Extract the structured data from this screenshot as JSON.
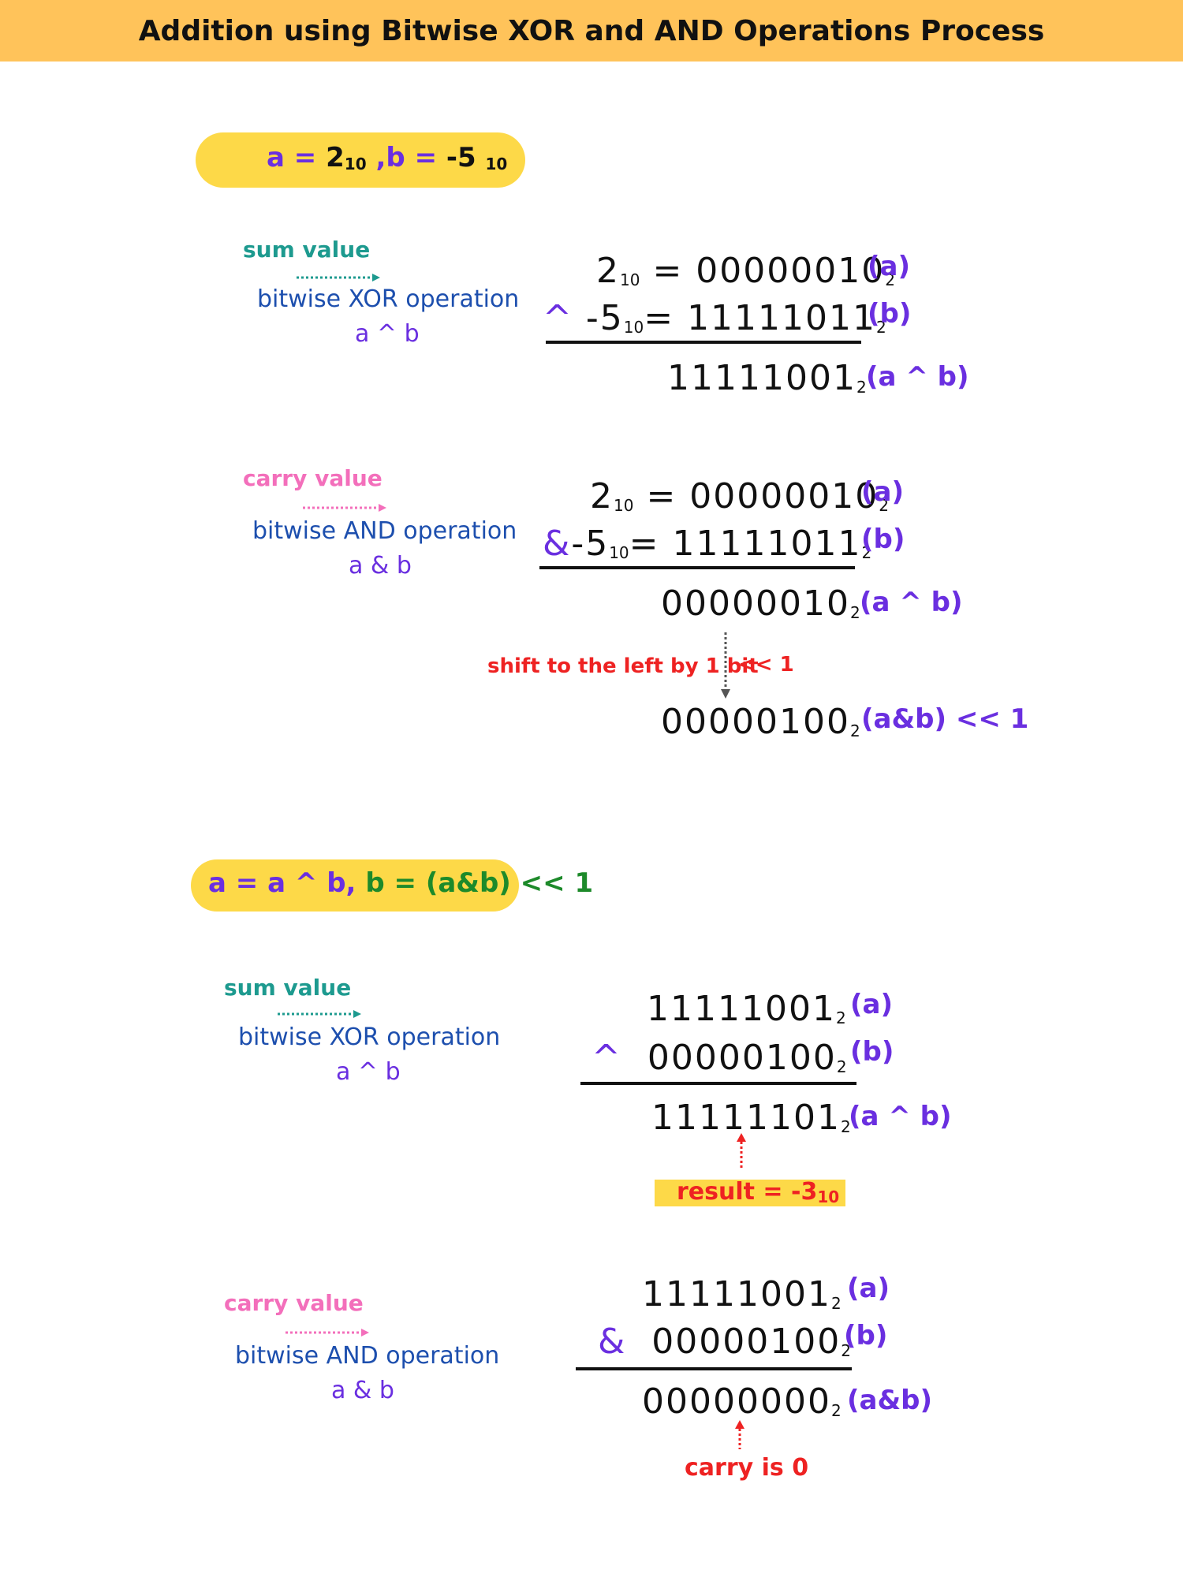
{
  "title": "Addition using Bitwise XOR and AND Operations Process",
  "init": {
    "a_label": "a = ",
    "a_val": "2",
    "a_base": "10",
    "sep": " ,",
    "b_label": "b = ",
    "b_val": "-5",
    "b_base": "10"
  },
  "s1_xor": {
    "side_label": "sum  value",
    "op_name": "bitwise XOR operation",
    "op_expr": "a ^ b",
    "row1_dec": "2",
    "row1_base": "10",
    "row1_bin": "00000010",
    "row1_bbase": "2",
    "row1_tag": "(a)",
    "row2_op": "^",
    "row2_dec": "-5",
    "row2_base": "10",
    "row2_bin": "11111011",
    "row2_bbase": "2",
    "row2_tag": "(b)",
    "res_bin": "11111001",
    "res_bbase": "2",
    "res_tag": "(a ^ b)"
  },
  "s1_and": {
    "side_label": "carry  value",
    "op_name": "bitwise AND operation",
    "op_expr": "a & b",
    "row1_dec": "2",
    "row1_base": "10",
    "row1_bin": "00000010",
    "row1_bbase": "2",
    "row1_tag": "(a)",
    "row2_op": "&",
    "row2_dec": "-5",
    "row2_base": "10",
    "row2_bin": "11111011",
    "row2_bbase": "2",
    "row2_tag": "(b)",
    "res_bin": "00000010",
    "res_bbase": "2",
    "res_tag": "(a ^ b)",
    "shift_note": "shift to the left by 1 bit",
    "shift_op": "<< 1",
    "shift_bin": "00000100",
    "shift_bbase": "2",
    "shift_tag": "(a&b) << 1"
  },
  "assign": {
    "a_part": "a = a ^ b, ",
    "b_part": "b = (a&b) << 1"
  },
  "s2_xor": {
    "side_label": "sum  value",
    "op_name": "bitwise XOR operation",
    "op_expr": "a ^ b",
    "row1_bin": "11111001",
    "row1_bbase": "2",
    "row1_tag": "(a)",
    "row2_op": "^",
    "row2_bin": "00000100",
    "row2_bbase": "2",
    "row2_tag": "(b)",
    "res_bin": "11111101",
    "res_bbase": "2",
    "res_tag": "(a ^ b)",
    "result_note": "result = -3",
    "result_base": "10"
  },
  "s2_and": {
    "side_label": "carry  value",
    "op_name": "bitwise AND operation",
    "op_expr": "a & b",
    "row1_bin": "11111001",
    "row1_bbase": "2",
    "row1_tag": "(a)",
    "row2_op": "&",
    "row2_bin": "00000100",
    "row2_bbase": "2",
    "row2_tag": "(b)",
    "res_bin": "00000000",
    "res_bbase": "2",
    "res_tag": "(a&b)",
    "carry_note": "carry is 0"
  },
  "colors": {
    "banner": "#ffc35a",
    "highlight": "#fdd948",
    "purple": "#6a2fe0",
    "teal": "#1d9a8f",
    "pink": "#f36fbb",
    "blue": "#1d4fae",
    "red": "#ee2222",
    "green": "#1d8a2a"
  }
}
